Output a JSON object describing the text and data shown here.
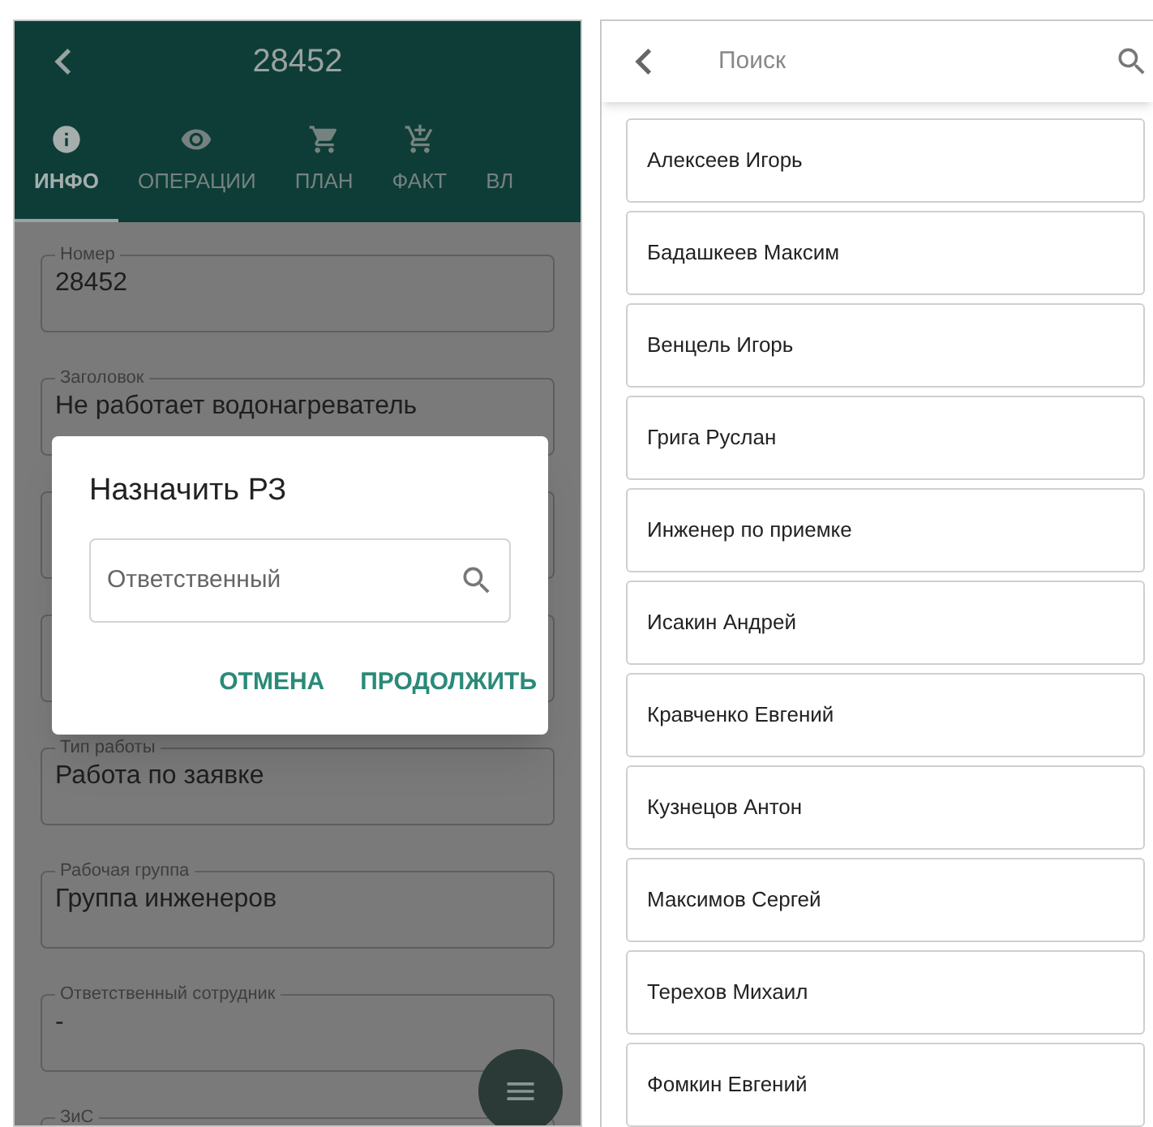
{
  "detail_screen": {
    "title": "28452",
    "tabs": [
      {
        "label": "ИНФО",
        "selected": true,
        "kind": "info"
      },
      {
        "label": "ОПЕРАЦИИ",
        "selected": false,
        "kind": "eye"
      },
      {
        "label": "ПЛАН",
        "selected": false,
        "kind": "cart"
      },
      {
        "label": "ФАКТ",
        "selected": false,
        "kind": "cartplus"
      },
      {
        "label": "ВЛ",
        "selected": false,
        "kind": "plain"
      }
    ],
    "fields": [
      {
        "kind": "text",
        "label": "Номер",
        "value": "28452"
      },
      {
        "kind": "text",
        "label": "Заголовок",
        "value": "Не работает водонагреватель"
      },
      {
        "kind": "covered"
      },
      {
        "kind": "covered"
      },
      {
        "kind": "text",
        "label": "Тип работы",
        "value": "Работа по заявке"
      },
      {
        "kind": "text",
        "label": "Рабочая группа",
        "value": "Группа инженеров"
      },
      {
        "kind": "text",
        "label": "Ответственный сотрудник",
        "value": "-"
      },
      {
        "kind": "text",
        "label": "ЗиС"
      }
    ],
    "dialog": {
      "title": "Назначить РЗ",
      "search": {
        "placeholder": "Ответственный"
      },
      "buttons": [
        "ОТМЕНА",
        "ПРОДОЛЖИТЬ"
      ]
    }
  },
  "search_screen": {
    "search": {
      "placeholder": "Поиск"
    },
    "items": [
      "Алексеев Игорь",
      "Бадашкеев Максим",
      "Венцель Игорь",
      "Грига Руслан",
      "Инженер по приемке",
      "Исакин Андрей",
      "Кравченко Евгений",
      "Кузнецов Антон",
      "Максимов Сергей",
      "Терехов Михаил",
      "Фомкин Евгений"
    ]
  }
}
